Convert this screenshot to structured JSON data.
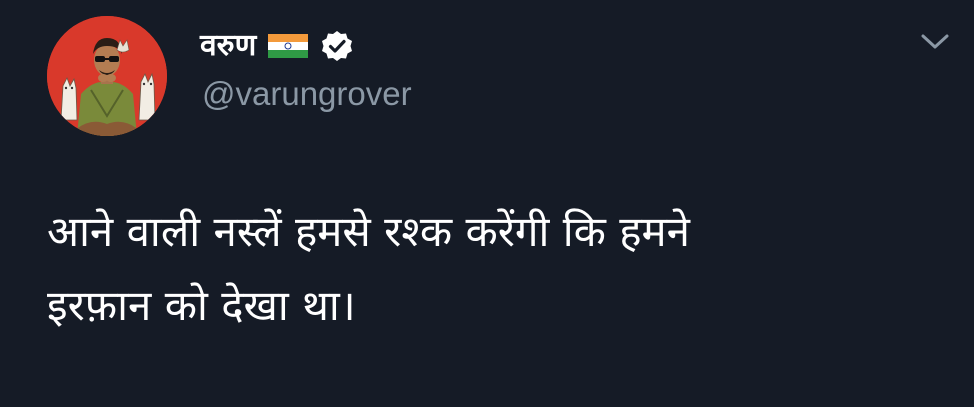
{
  "tweet": {
    "display_name": "वरुण",
    "handle": "@varungrover",
    "text_line1": "आने वाली नस्लें हमसे रश्क करेंगी कि हमने",
    "text_line2": "इरफ़ान को देखा था।",
    "flag_icon": "india-flag-icon",
    "verified_icon": "verified-badge-icon",
    "menu_icon": "chevron-down-icon",
    "avatar_bg_color": "#d9392b"
  },
  "colors": {
    "background": "#151b26",
    "name": "#ffffff",
    "handle": "#8b98a5",
    "chevron": "#8b98a5"
  }
}
